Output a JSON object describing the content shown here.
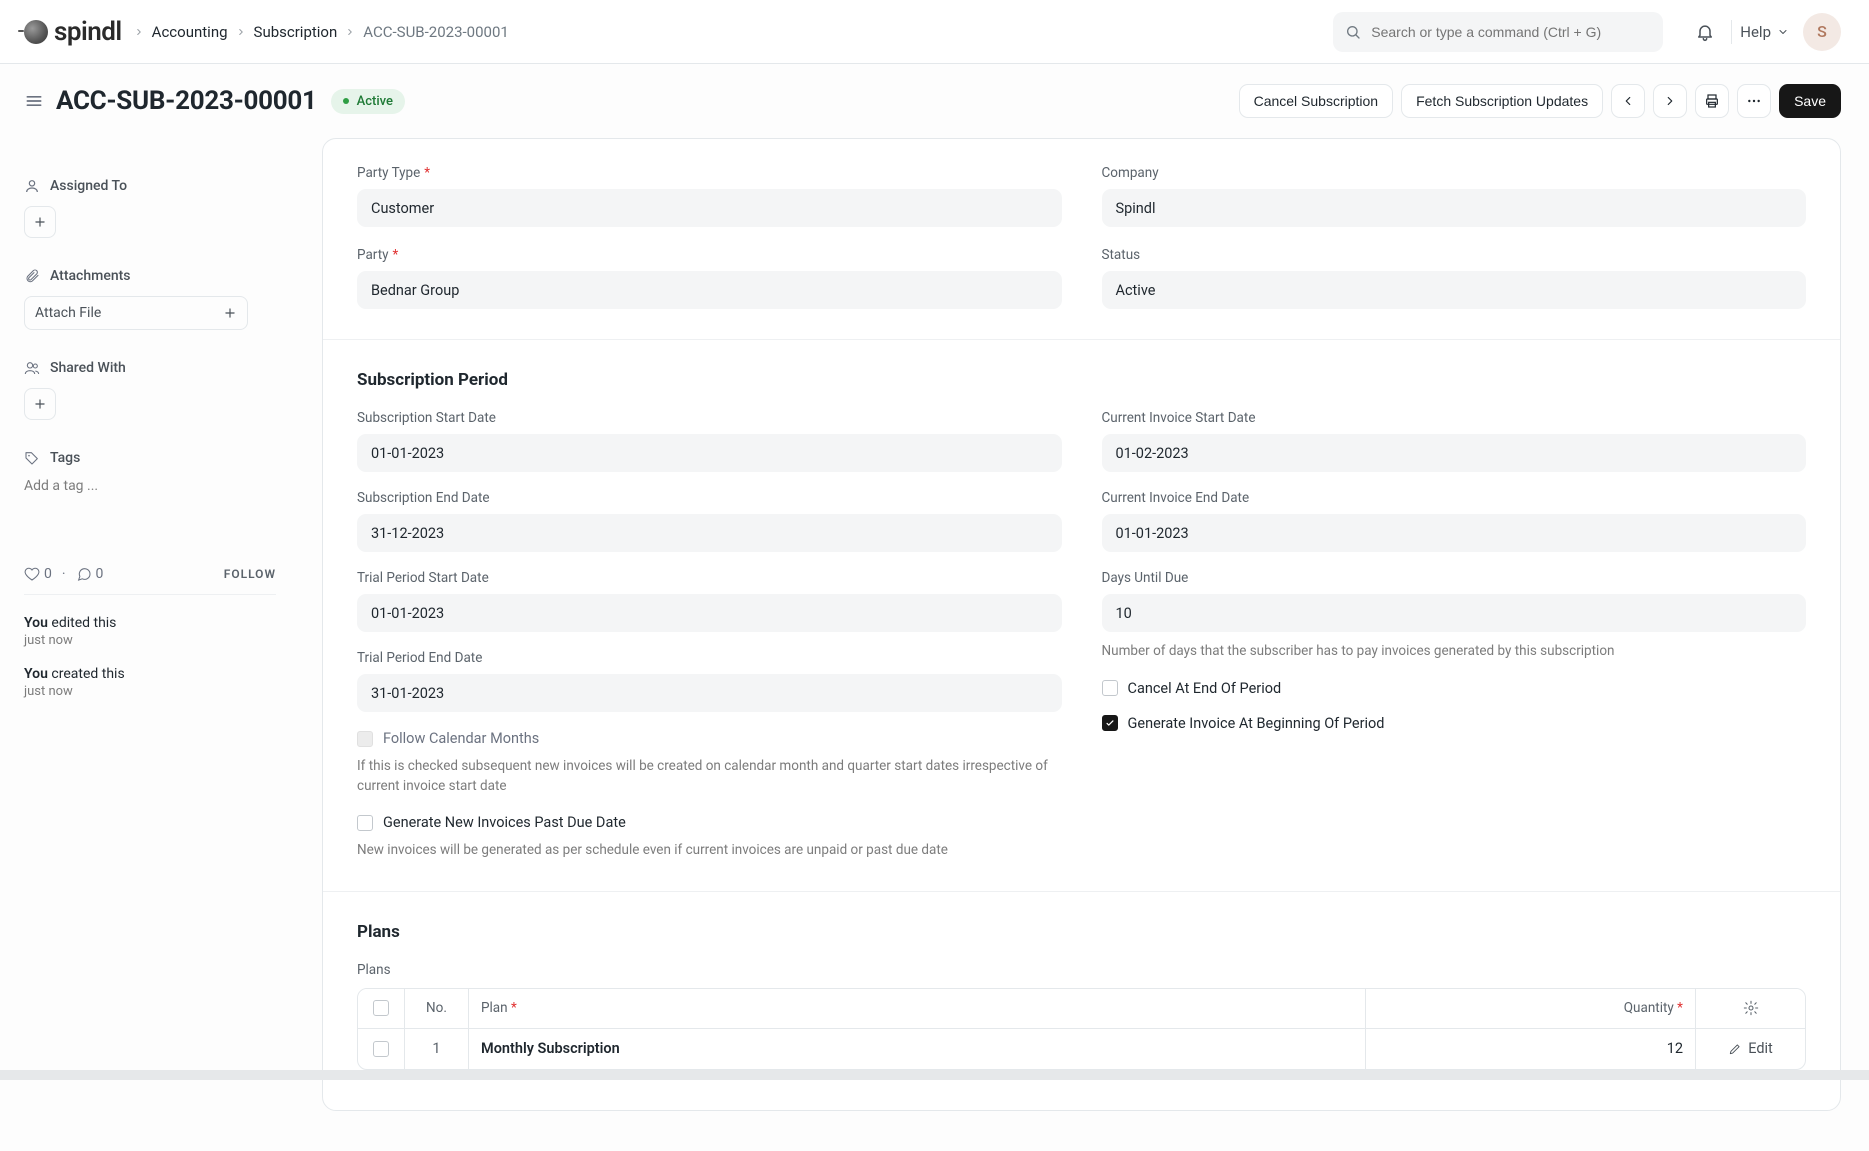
{
  "app": {
    "logo_text": "spindl",
    "search_placeholder": "Search or type a command (Ctrl + G)",
    "help_label": "Help",
    "avatar_initial": "S"
  },
  "breadcrumbs": {
    "items": [
      "Accounting",
      "Subscription",
      "ACC-SUB-2023-00001"
    ]
  },
  "header": {
    "title": "ACC-SUB-2023-00001",
    "status": "Active",
    "cancel_btn": "Cancel Subscription",
    "fetch_btn": "Fetch Subscription Updates",
    "save_btn": "Save"
  },
  "sidebar": {
    "assigned_to_label": "Assigned To",
    "attachments_label": "Attachments",
    "attach_file_label": "Attach File",
    "shared_with_label": "Shared With",
    "tags_label": "Tags",
    "tags_placeholder": "Add a tag ...",
    "likes_count": "0",
    "comments_count": "0",
    "follow_label": "FOLLOW",
    "history": [
      {
        "who": "You",
        "action": "edited this",
        "time": "just now"
      },
      {
        "who": "You",
        "action": "created this",
        "time": "just now"
      }
    ]
  },
  "form": {
    "party_type": {
      "label": "Party Type",
      "required": true,
      "value": "Customer"
    },
    "company": {
      "label": "Company",
      "value": "Spindl"
    },
    "party": {
      "label": "Party",
      "required": true,
      "value": "Bednar Group"
    },
    "status": {
      "label": "Status",
      "value": "Active"
    },
    "section_period_title": "Subscription Period",
    "sub_start": {
      "label": "Subscription Start Date",
      "value": "01-01-2023"
    },
    "cur_inv_start": {
      "label": "Current Invoice Start Date",
      "value": "01-02-2023"
    },
    "sub_end": {
      "label": "Subscription End Date",
      "value": "31-12-2023"
    },
    "cur_inv_end": {
      "label": "Current Invoice End Date",
      "value": "01-01-2023"
    },
    "trial_start": {
      "label": "Trial Period Start Date",
      "value": "01-01-2023"
    },
    "days_due": {
      "label": "Days Until Due",
      "value": "10",
      "help": "Number of days that the subscriber has to pay invoices generated by this subscription"
    },
    "trial_end": {
      "label": "Trial Period End Date",
      "value": "31-01-2023"
    },
    "follow_calendar": {
      "label": "Follow Calendar Months",
      "help": "If this is checked subsequent new invoices will be created on calendar month and quarter start dates irrespective of current invoice start date",
      "checked": false
    },
    "cancel_end": {
      "label": "Cancel At End Of Period",
      "checked": false
    },
    "gen_begin": {
      "label": "Generate Invoice At Beginning Of Period",
      "checked": true
    },
    "gen_past_due": {
      "label": "Generate New Invoices Past Due Date",
      "help": "New invoices will be generated as per schedule even if current invoices are unpaid or past due date",
      "checked": false
    },
    "section_plans_title": "Plans",
    "plans_label": "Plans",
    "plans_table": {
      "headers": {
        "no": "No.",
        "plan": "Plan",
        "qty": "Quantity"
      },
      "rows": [
        {
          "no": "1",
          "plan": "Monthly Subscription",
          "qty": "12",
          "edit_label": "Edit"
        }
      ]
    }
  }
}
